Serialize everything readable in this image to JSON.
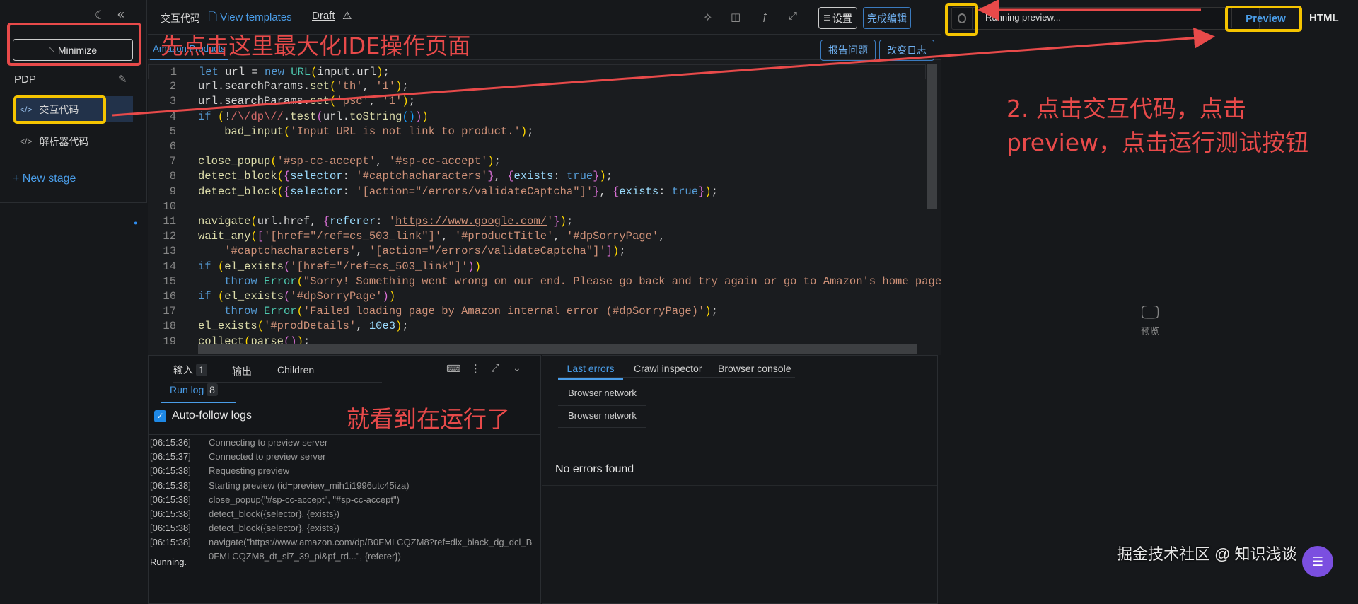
{
  "sidebar": {
    "minimize_label": "Minimize",
    "project": "PDP",
    "stages": [
      {
        "label": "交互代码",
        "active": true
      },
      {
        "label": "解析器代码",
        "active": false
      }
    ],
    "new_stage": "+ New stage"
  },
  "header": {
    "title": "交互代码",
    "view_templates": "View templates",
    "draft": "Draft",
    "settings": "设置",
    "done": "完成编辑",
    "report": "报告问题",
    "changelog": "改变日志",
    "file_tab": "Amazon Products"
  },
  "code": [
    [
      [
        "kw",
        "let"
      ],
      [
        "p",
        " url = "
      ],
      [
        "kw",
        "new"
      ],
      [
        "p",
        " "
      ],
      [
        "ty",
        "URL"
      ],
      [
        "b",
        "("
      ],
      [
        "p",
        "input.url"
      ],
      [
        "b",
        ")"
      ],
      [
        "p",
        ";"
      ]
    ],
    [
      [
        "p",
        "url.searchParams."
      ],
      [
        "fn",
        "set"
      ],
      [
        "b",
        "("
      ],
      [
        "s",
        "'th'"
      ],
      [
        "p",
        ", "
      ],
      [
        "s",
        "'1'"
      ],
      [
        "b",
        ")"
      ],
      [
        "p",
        ";"
      ]
    ],
    [
      [
        "p",
        "url.searchParams."
      ],
      [
        "fn",
        "set"
      ],
      [
        "b",
        "("
      ],
      [
        "s",
        "'psc'"
      ],
      [
        "p",
        ", "
      ],
      [
        "s",
        "'1'"
      ],
      [
        "b",
        ")"
      ],
      [
        "p",
        ";"
      ]
    ],
    [
      [
        "kw",
        "if"
      ],
      [
        "p",
        " "
      ],
      [
        "b",
        "("
      ],
      [
        "p",
        "!"
      ],
      [
        "re",
        "/\\/dp\\//"
      ],
      [
        "p",
        "."
      ],
      [
        "fn",
        "test"
      ],
      [
        "b2",
        "("
      ],
      [
        "p",
        "url."
      ],
      [
        "fn",
        "toString"
      ],
      [
        "b3",
        "()"
      ],
      [
        "b2",
        ")"
      ],
      [
        "b",
        ")"
      ]
    ],
    [
      [
        "p",
        "    "
      ],
      [
        "fn",
        "bad_input"
      ],
      [
        "b",
        "("
      ],
      [
        "s",
        "'Input URL is not link to product.'"
      ],
      [
        "b",
        ")"
      ],
      [
        "p",
        ";"
      ]
    ],
    [],
    [
      [
        "fn",
        "close_popup"
      ],
      [
        "b",
        "("
      ],
      [
        "s",
        "'#sp-cc-accept'"
      ],
      [
        "p",
        ", "
      ],
      [
        "s",
        "'#sp-cc-accept'"
      ],
      [
        "b",
        ")"
      ],
      [
        "p",
        ";"
      ]
    ],
    [
      [
        "fn",
        "detect_block"
      ],
      [
        "b",
        "("
      ],
      [
        "b2",
        "{"
      ],
      [
        "c",
        "selector"
      ],
      [
        "p",
        ": "
      ],
      [
        "s",
        "'#captchacharacters'"
      ],
      [
        "b2",
        "}"
      ],
      [
        "p",
        ", "
      ],
      [
        "b2",
        "{"
      ],
      [
        "c",
        "exists"
      ],
      [
        "p",
        ": "
      ],
      [
        "kw",
        "true"
      ],
      [
        "b2",
        "}"
      ],
      [
        "b",
        ")"
      ],
      [
        "p",
        ";"
      ]
    ],
    [
      [
        "fn",
        "detect_block"
      ],
      [
        "b",
        "("
      ],
      [
        "b2",
        "{"
      ],
      [
        "c",
        "selector"
      ],
      [
        "p",
        ": "
      ],
      [
        "s",
        "'[action=\"/errors/validateCaptcha\"]'"
      ],
      [
        "b2",
        "}"
      ],
      [
        "p",
        ", "
      ],
      [
        "b2",
        "{"
      ],
      [
        "c",
        "exists"
      ],
      [
        "p",
        ": "
      ],
      [
        "kw",
        "true"
      ],
      [
        "b2",
        "}"
      ],
      [
        "b",
        ")"
      ],
      [
        "p",
        ";"
      ]
    ],
    [],
    [
      [
        "fn",
        "navigate"
      ],
      [
        "b",
        "("
      ],
      [
        "p",
        "url.href, "
      ],
      [
        "b2",
        "{"
      ],
      [
        "c",
        "referer"
      ],
      [
        "p",
        ": "
      ],
      [
        "s",
        "'"
      ],
      [
        "u",
        "https://www.google.com/"
      ],
      [
        "s",
        "'"
      ],
      [
        "b2",
        "}"
      ],
      [
        "b",
        ")"
      ],
      [
        "p",
        ";"
      ]
    ],
    [
      [
        "fn",
        "wait_any"
      ],
      [
        "b",
        "("
      ],
      [
        "b2",
        "["
      ],
      [
        "s",
        "'[href=\"/ref=cs_503_link\"]'"
      ],
      [
        "p",
        ", "
      ],
      [
        "s",
        "'#productTitle'"
      ],
      [
        "p",
        ", "
      ],
      [
        "s",
        "'#dpSorryPage'"
      ],
      [
        "p",
        ","
      ]
    ],
    [
      [
        "p",
        "    "
      ],
      [
        "s",
        "'#captchacharacters'"
      ],
      [
        "p",
        ", "
      ],
      [
        "s",
        "'[action=\"/errors/validateCaptcha\"]'"
      ],
      [
        "b2",
        "]"
      ],
      [
        "b",
        ")"
      ],
      [
        "p",
        ";"
      ]
    ],
    [
      [
        "kw",
        "if"
      ],
      [
        "p",
        " "
      ],
      [
        "b",
        "("
      ],
      [
        "fn",
        "el_exists"
      ],
      [
        "b2",
        "("
      ],
      [
        "s",
        "'[href=\"/ref=cs_503_link\"]'"
      ],
      [
        "b2",
        ")"
      ],
      [
        "b",
        ")"
      ]
    ],
    [
      [
        "p",
        "    "
      ],
      [
        "kw",
        "throw"
      ],
      [
        "p",
        " "
      ],
      [
        "ty",
        "Error"
      ],
      [
        "b",
        "("
      ],
      [
        "s",
        "\"Sorry! Something went wrong on our end. Please go back and try again or go to Amazon's home page.\""
      ],
      [
        "b",
        ")"
      ],
      [
        "p",
        ";"
      ]
    ],
    [
      [
        "kw",
        "if"
      ],
      [
        "p",
        " "
      ],
      [
        "b",
        "("
      ],
      [
        "fn",
        "el_exists"
      ],
      [
        "b2",
        "("
      ],
      [
        "s",
        "'#dpSorryPage'"
      ],
      [
        "b2",
        ")"
      ],
      [
        "b",
        ")"
      ]
    ],
    [
      [
        "p",
        "    "
      ],
      [
        "kw",
        "throw"
      ],
      [
        "p",
        " "
      ],
      [
        "ty",
        "Error"
      ],
      [
        "b",
        "("
      ],
      [
        "s",
        "'Failed loading page by Amazon internal error (#dpSorryPage)'"
      ],
      [
        "b",
        ")"
      ],
      [
        "p",
        ";"
      ]
    ],
    [
      [
        "fn",
        "el_exists"
      ],
      [
        "b",
        "("
      ],
      [
        "s",
        "'#prodDetails'"
      ],
      [
        "p",
        ", "
      ],
      [
        "c",
        "10e3"
      ],
      [
        "b",
        ")"
      ],
      [
        "p",
        ";"
      ]
    ],
    [
      [
        "fn",
        "collect"
      ],
      [
        "b",
        "("
      ],
      [
        "fn",
        "parse"
      ],
      [
        "b2",
        "()"
      ],
      [
        "b",
        ")"
      ],
      [
        "p",
        ";"
      ]
    ]
  ],
  "bottom_left": {
    "tabs": [
      {
        "label": "输入",
        "count": "1"
      },
      {
        "label": "输出"
      },
      {
        "label": "Children"
      }
    ],
    "run_log": "Run log",
    "run_log_count": "8",
    "auto_follow": "Auto-follow logs",
    "auto_follow_checked": true,
    "logs": [
      {
        "time": "[06:15:36]",
        "msg": "Connecting to preview server"
      },
      {
        "time": "[06:15:37]",
        "msg": "Connected to preview server"
      },
      {
        "time": "[06:15:38]",
        "msg": "Requesting preview"
      },
      {
        "time": "[06:15:38]",
        "msg": "Starting preview (id=preview_mih1i1996utc45iza)"
      },
      {
        "time": "[06:15:38]",
        "msg": "close_popup(\"#sp-cc-accept\", \"#sp-cc-accept\")"
      },
      {
        "time": "[06:15:38]",
        "msg": "detect_block({selector}, {exists})"
      },
      {
        "time": "[06:15:38]",
        "msg": "detect_block({selector}, {exists})"
      },
      {
        "time": "[06:15:38]",
        "msg": "navigate(\"https://www.amazon.com/dp/B0FMLCQZM8?ref=dlx_black_dg_dcl_B0FMLCQZM8_dt_sl7_39_pi&pf_rd...\", {referer})"
      }
    ],
    "status": "Running."
  },
  "bottom_right": {
    "tabs": [
      "Last errors",
      "Crawl inspector",
      "Browser console"
    ],
    "sub_tabs": [
      "Browser network",
      "Browser network"
    ],
    "empty": "No errors found"
  },
  "preview": {
    "status": "Running preview...",
    "preview_tab": "Preview",
    "html_tab": "HTML",
    "placeholder": "预览"
  },
  "annotations": {
    "step1": "先点击这里最大化IDE操作页面",
    "step2_line1": "2. 点击交互代码，点击",
    "step2_line2": "preview，点击运行测试按钮",
    "running": "就看到在运行了"
  },
  "watermark": "掘金技术社区 @ 知识浅谈",
  "colors": {
    "accent": "#4a9de8",
    "annotation_red": "#e84a4a",
    "highlight_yellow": "#f5c400"
  }
}
